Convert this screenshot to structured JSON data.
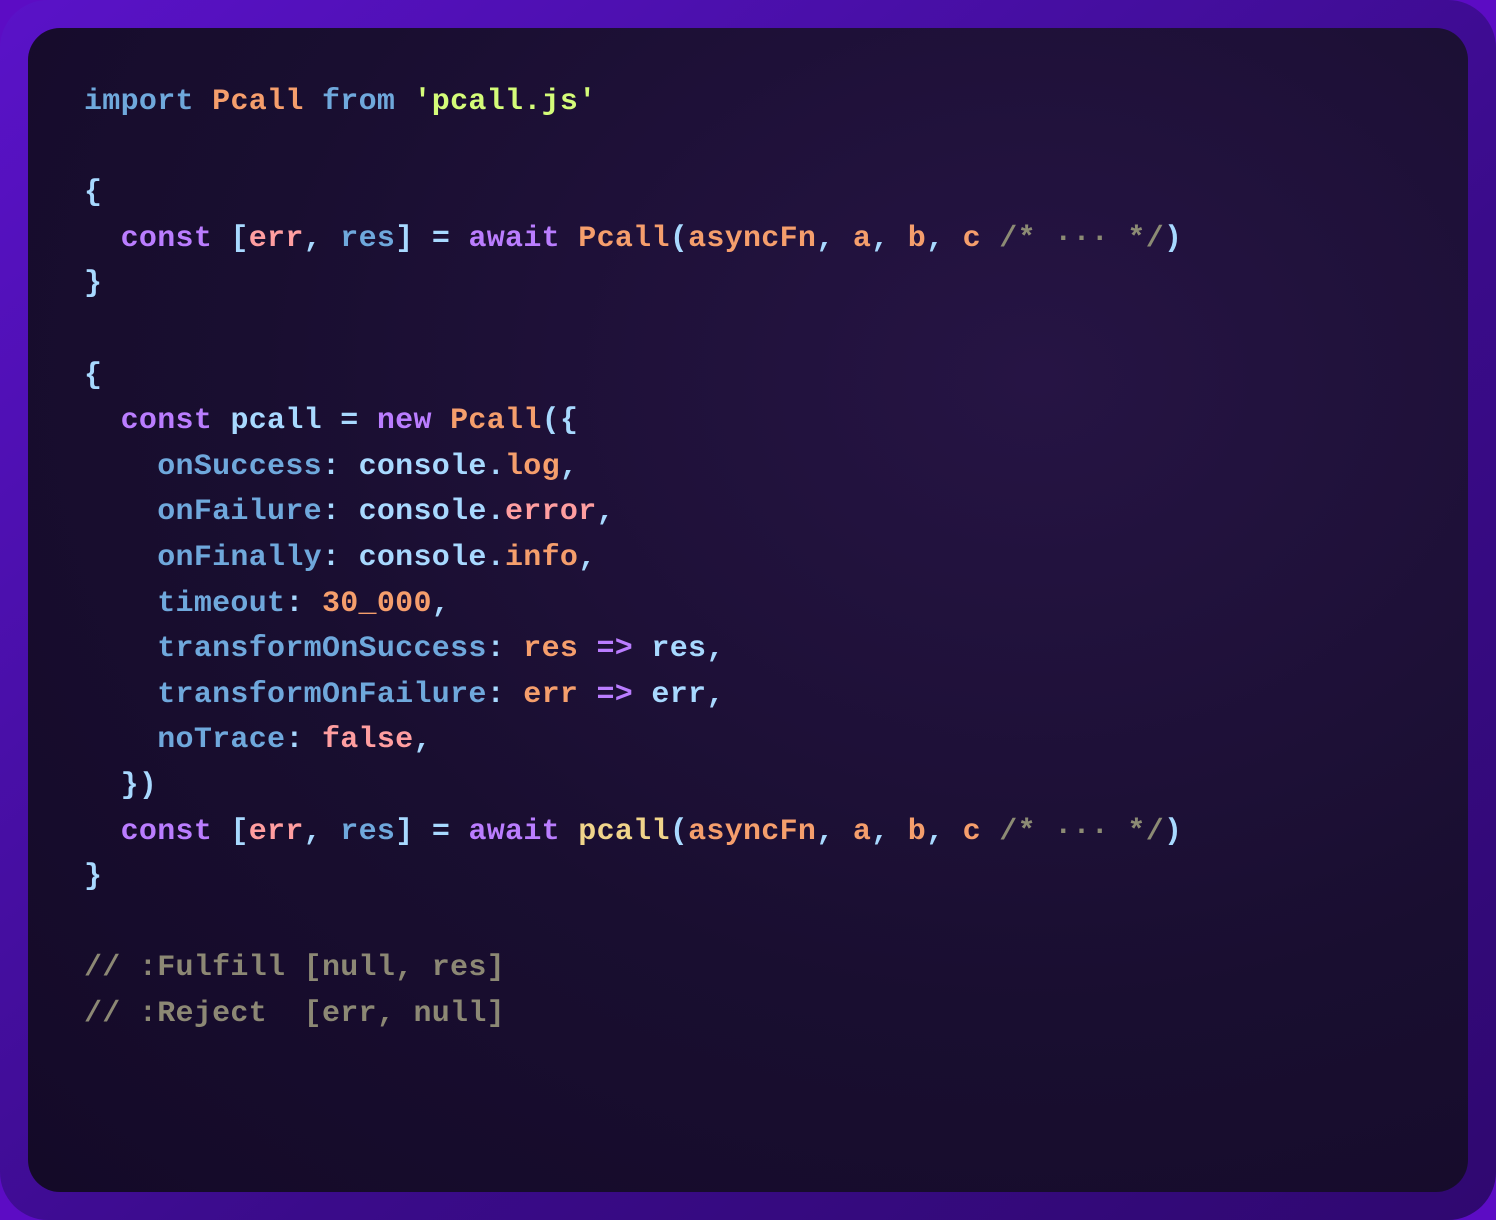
{
  "code": {
    "l1_import": "import",
    "l1_class": "Pcall",
    "l1_from": "from",
    "l1_str": "'pcall.js'",
    "l3_open": "{",
    "l4_const": "const",
    "l4_lbr": "[",
    "l4_err": "err",
    "l4_c1": ", ",
    "l4_res": "res",
    "l4_rbr": "]",
    "l4_eq": " = ",
    "l4_await": "await",
    "l4_call": "Pcall",
    "l4_open": "(",
    "l4_asyncFn": "asyncFn",
    "l4_c2": ", ",
    "l4_a": "a",
    "l4_c3": ", ",
    "l4_b": "b",
    "l4_c4": ", ",
    "l4_cc": "c",
    "l4_sp": " ",
    "l4_cmt": "/* ··· */",
    "l4_close": ")",
    "l5_close": "}",
    "l7_open": "{",
    "l8_const": "const",
    "l8_name": "pcall",
    "l8_eq": " = ",
    "l8_new": "new",
    "l8_class": "Pcall",
    "l8_open": "(",
    "l8_brace": "{",
    "l9_prop": "onSuccess",
    "l9_col": ": ",
    "l9_obj": "console",
    "l9_dot": ".",
    "l9_meth": "log",
    "l9_comma": ",",
    "l10_prop": "onFailure",
    "l10_col": ": ",
    "l10_obj": "console",
    "l10_dot": ".",
    "l10_meth": "error",
    "l10_comma": ",",
    "l11_prop": "onFinally",
    "l11_col": ": ",
    "l11_obj": "console",
    "l11_dot": ".",
    "l11_meth": "info",
    "l11_comma": ",",
    "l12_prop": "timeout",
    "l12_col": ": ",
    "l12_num": "30_000",
    "l12_comma": ",",
    "l13_prop": "transformOnSuccess",
    "l13_col": ": ",
    "l13_p1": "res",
    "l13_arrow": " => ",
    "l13_p2": "res",
    "l13_comma": ",",
    "l14_prop": "transformOnFailure",
    "l14_col": ": ",
    "l14_p1": "err",
    "l14_arrow": " => ",
    "l14_p2": "err",
    "l14_comma": ",",
    "l15_prop": "noTrace",
    "l15_col": ": ",
    "l15_val": "false",
    "l15_comma": ",",
    "l16_brace": "}",
    "l16_close": ")",
    "l17_const": "const",
    "l17_lbr": "[",
    "l17_err": "err",
    "l17_c1": ", ",
    "l17_res": "res",
    "l17_rbr": "]",
    "l17_eq": " = ",
    "l17_await": "await",
    "l17_call": "pcall",
    "l17_open": "(",
    "l17_asyncFn": "asyncFn",
    "l17_c2": ", ",
    "l17_a": "a",
    "l17_c3": ", ",
    "l17_b": "b",
    "l17_c4": ", ",
    "l17_cc": "c",
    "l17_sp": " ",
    "l17_cmt": "/* ··· */",
    "l17_close": ")",
    "l18_close": "}",
    "l20_cmt": "// :Fulfill [null, res]",
    "l21_cmt": "// :Reject  [err, null]"
  }
}
